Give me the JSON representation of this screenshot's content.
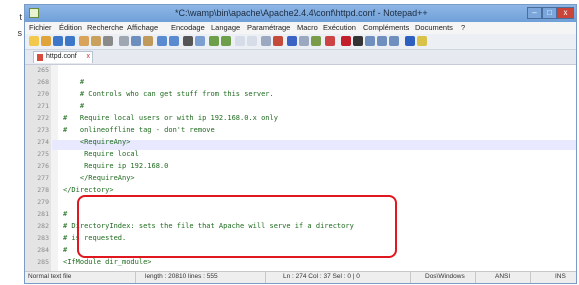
{
  "left_crop": [
    "t",
    "s"
  ],
  "window": {
    "title": "*C:\\wamp\\bin\\apache\\Apache2.4.4\\conf\\httpd.conf - Notepad++"
  },
  "menu": [
    "Fichier",
    "Édition",
    "Recherche",
    "Affichage",
    "Encodage",
    "Langage",
    "Paramétrage",
    "Macro",
    "Exécution",
    "Compléments",
    "Documents",
    "?"
  ],
  "tab": {
    "label": "httpd.conf"
  },
  "lines": [
    {
      "n": "265",
      "text": ""
    },
    {
      "n": "268",
      "text": "    #"
    },
    {
      "n": "270",
      "text": "    # Controls who can get stuff from this server."
    },
    {
      "n": "271",
      "text": "    #"
    },
    {
      "n": "272",
      "text": "#   Require local users or with ip 192.168.0.x only"
    },
    {
      "n": "273",
      "text": "#   onlineoffline tag - don't remove"
    },
    {
      "n": "274",
      "text": "    <RequireAny>"
    },
    {
      "n": "275",
      "text": "     Require local"
    },
    {
      "n": "276",
      "text": "     Require ip 192.168.0"
    },
    {
      "n": "277",
      "text": "    </RequireAny>"
    },
    {
      "n": "278",
      "text": "</Directory>"
    },
    {
      "n": "279",
      "text": ""
    },
    {
      "n": "281",
      "text": "#"
    },
    {
      "n": "282",
      "text": "# DirectoryIndex: sets the file that Apache will serve if a directory"
    },
    {
      "n": "283",
      "text": "# is requested."
    },
    {
      "n": "284",
      "text": "#"
    },
    {
      "n": "285",
      "text": "<IfModule dir_module>"
    }
  ],
  "status": {
    "type": "Normal text file",
    "length": "length : 20810    lines : 555",
    "pos": "Ln : 274    Col : 37    Sel : 0 | 0",
    "eol": "Dos\\Windows",
    "enc": "ANSI",
    "mode": "INS"
  }
}
